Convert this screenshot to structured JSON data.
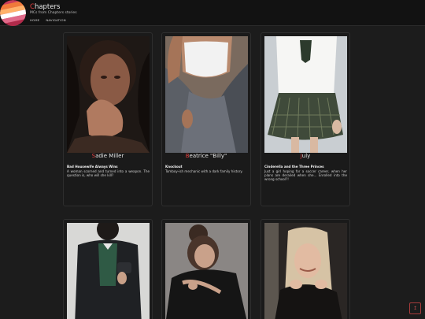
{
  "header": {
    "title_initial": "C",
    "title_rest": "hapters",
    "subtitle": "MCs from Chapters stories",
    "nav": [
      "HOME",
      "NAVIGATION"
    ]
  },
  "cards": [
    {
      "initial": "S",
      "name_rest": "adie Miller",
      "story": "Bad Housewife Always Wins",
      "desc": "A woman scorned and turned into a weapon. The question is, who will she kill?",
      "image": "woman-crying-portrait"
    },
    {
      "initial": "B",
      "name_rest": "eatrice \"Billy\"",
      "story": "Knockout",
      "desc": "Tomboy-ish mechanic with a dark family history.",
      "image": "woman-in-work-shirt"
    },
    {
      "initial": "J",
      "name_rest": "uly",
      "story": "Cinderella and the Three Princes",
      "desc": "Just a girl hoping for a soccer career, when her plans are derailed when she... Enrolled into the wrong school?!",
      "image": "girl-in-school-uniform"
    },
    {
      "image": "boy-in-school-blazer"
    },
    {
      "image": "woman-with-hair-bun"
    },
    {
      "image": "smiling-blonde-woman"
    }
  ],
  "corner_button": "↥",
  "colors": {
    "accent": "#e23e3e",
    "background": "#1c1c1c",
    "header": "#121212"
  }
}
